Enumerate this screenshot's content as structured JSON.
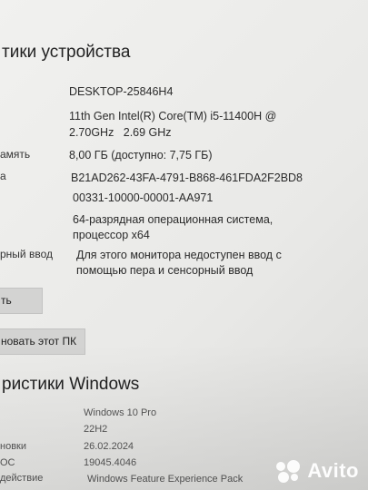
{
  "device_specs": {
    "title": "тики устройства",
    "device_name": "DESKTOP-25846H4",
    "processor_line1": "11th Gen Intel(R) Core(TM) i5-11400H @",
    "processor_line2": "2.70GHz   2.69 GHz",
    "ram_label": "амять",
    "ram_value": "8,00 ГБ (доступно: 7,75 ГБ)",
    "device_id_label": "а",
    "device_id": "B21AD262-43FA-4791-B868-461FDA2F2BD8",
    "product_id": "00331-10000-00001-AA971",
    "system_type_line1": "64-разрядная операционная система,",
    "system_type_line2": "процессор x64",
    "pen_touch_label": "рный ввод",
    "pen_touch_line1": "Для этого монитора недоступен ввод с",
    "pen_touch_line2": "помощью пера и сенсорный ввод"
  },
  "buttons": {
    "copy_label": "ть",
    "rename_label": "новать этот ПК"
  },
  "windows_specs": {
    "title": "ристики Windows",
    "edition": "Windows 10 Pro",
    "version": "22H2",
    "installed_label": "новки",
    "installed_date": "26.02.2024",
    "os_build_label": "ОС",
    "os_build": "19045.4046",
    "experience_label": "действие",
    "experience_value": "Windows Feature Experience Pack"
  },
  "watermark": {
    "brand": "Avito"
  }
}
